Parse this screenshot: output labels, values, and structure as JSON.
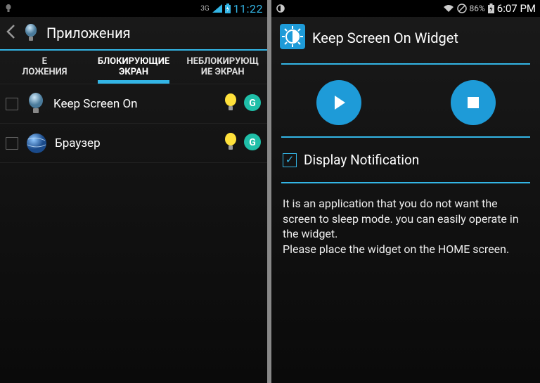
{
  "left": {
    "status": {
      "network": "3G",
      "time": "11:22"
    },
    "header": {
      "title": "Приложения"
    },
    "tabs": [
      {
        "label": "Е\nЛОЖЕНИЯ"
      },
      {
        "label": "БЛОКИРУЮЩИЕ\nЭКРАН",
        "active": true
      },
      {
        "label": "НЕБЛОКИРУЮЩ\nИЕ ЭКРАН"
      }
    ],
    "apps": [
      {
        "name": "Keep Screen On"
      },
      {
        "name": "Браузер"
      }
    ]
  },
  "right": {
    "status": {
      "battery": "86%",
      "time": "6:07 PM"
    },
    "header": {
      "title": "Keep Screen On Widget"
    },
    "checkbox": {
      "label": "Display Notification",
      "checked": true
    },
    "description": "It is an application that you do not want the screen to sleep mode. you can easily operate in the widget.\nPlease place the widget on the HOME screen."
  }
}
